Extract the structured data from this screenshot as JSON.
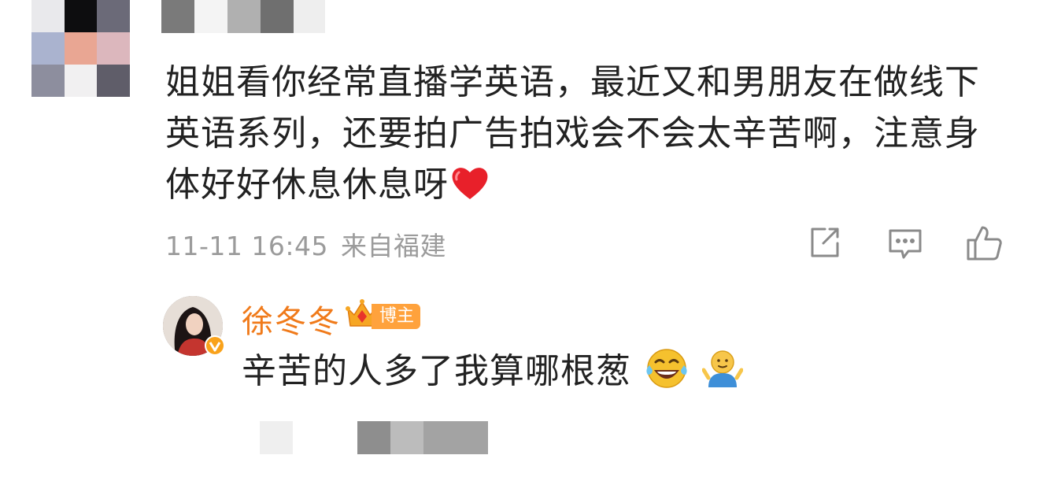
{
  "comment": {
    "text": "姐姐看你经常直播学英语，最近又和男朋友在做线下英语系列，还要拍广告拍戏会不会太辛苦啊，注意身体好好休息休息呀",
    "emoji": "heart-icon",
    "timestamp": "11-11 16:45",
    "location": "来自福建",
    "actions": [
      "share-icon",
      "reply-comment-icon",
      "like-icon"
    ]
  },
  "reply": {
    "author": "徐冬冬",
    "author_tag": "博主",
    "text": "辛苦的人多了我算哪根葱",
    "emojis": [
      "laugh-cry-emoji",
      "shrug-emoji"
    ]
  },
  "colors": {
    "text": "#222222",
    "meta": "#9b9b9b",
    "author_name": "#f07a1a",
    "author_tag_bg": "#ffa23c"
  }
}
